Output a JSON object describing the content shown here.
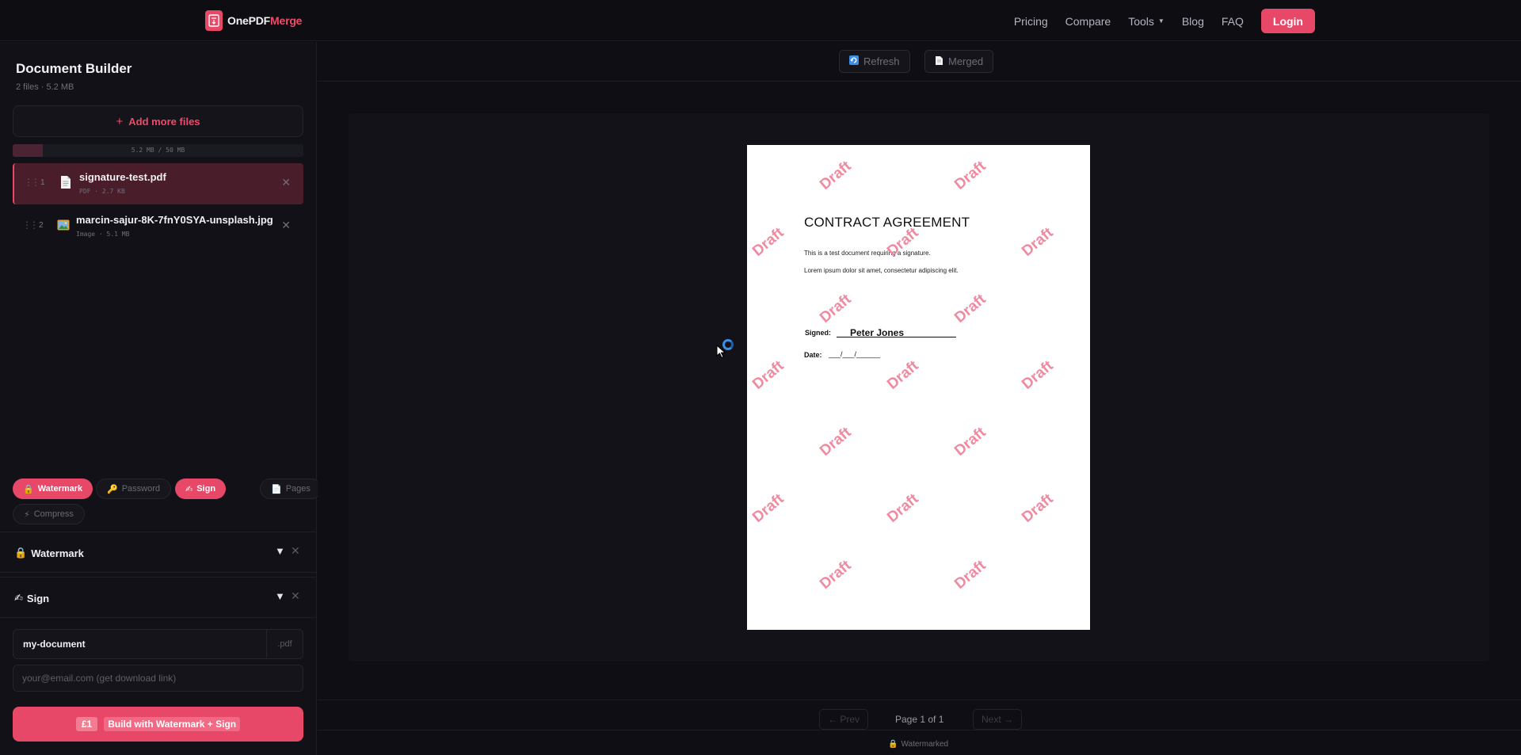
{
  "header": {
    "logo_prefix": "OnePDF",
    "logo_accent": "Merge",
    "nav": [
      {
        "label": "Pricing"
      },
      {
        "label": "Compare"
      },
      {
        "label": "Tools"
      },
      {
        "label": "Blog"
      },
      {
        "label": "FAQ"
      }
    ],
    "login_label": "Login"
  },
  "sidebar": {
    "title": "Document Builder",
    "subtitle": "2 files · 5.2 MB",
    "add_files_label": "Add more files",
    "usage": {
      "text": "5.2 MB / 50 MB",
      "fraction": 0.104
    },
    "files": [
      {
        "index": "1",
        "name": "signature-test.pdf",
        "meta": "PDF · 2.7 KB",
        "icon": "document-icon",
        "active": true
      },
      {
        "index": "2",
        "name": "marcin-sajur-8K-7fnY0SYA-unsplash.jpg",
        "meta": "Image · 5.1 MB",
        "icon": "image-icon",
        "active": false
      }
    ],
    "tools": [
      {
        "label": "Watermark",
        "icon": "lock-icon",
        "active": true
      },
      {
        "label": "Password",
        "icon": "key-icon",
        "active": false
      },
      {
        "label": "Sign",
        "icon": "writing-hand-icon",
        "active": true
      },
      {
        "label": "Pages",
        "icon": "page-icon",
        "active": false
      },
      {
        "label": "Compress",
        "icon": "lightning-icon",
        "active": false
      }
    ],
    "sections": [
      {
        "title": "Watermark",
        "icon": "lock-icon"
      },
      {
        "title": "Sign",
        "icon": "writing-hand-icon"
      }
    ],
    "filename_value": "my-document",
    "filename_ext": ".pdf",
    "email_placeholder": "your@email.com (get download link)",
    "build": {
      "price": "£1",
      "label": "Build with Watermark + Sign"
    }
  },
  "main": {
    "toolbar": [
      {
        "label": "Refresh",
        "icon": "refresh-icon"
      },
      {
        "label": "Merged",
        "icon": "document-icon"
      }
    ],
    "document": {
      "title": "CONTRACT AGREEMENT",
      "line1": "This is a test document requiring a signature.",
      "line2": "Lorem ipsum dolor sit amet, consectetur adipiscing elit.",
      "signed_label": "Signed:",
      "signature_name": "Peter Jones",
      "date_label": "Date:",
      "date_value": "___/___/______",
      "watermark_text": "Draft"
    },
    "pager": {
      "prev_label": "← Prev",
      "page_label": "Page 1 of 1",
      "next_label": "Next →"
    },
    "footer_note": "Watermarked"
  },
  "colors": {
    "accent": "#e84868",
    "background": "#0d0d12",
    "watermark": "#f08aa0"
  }
}
